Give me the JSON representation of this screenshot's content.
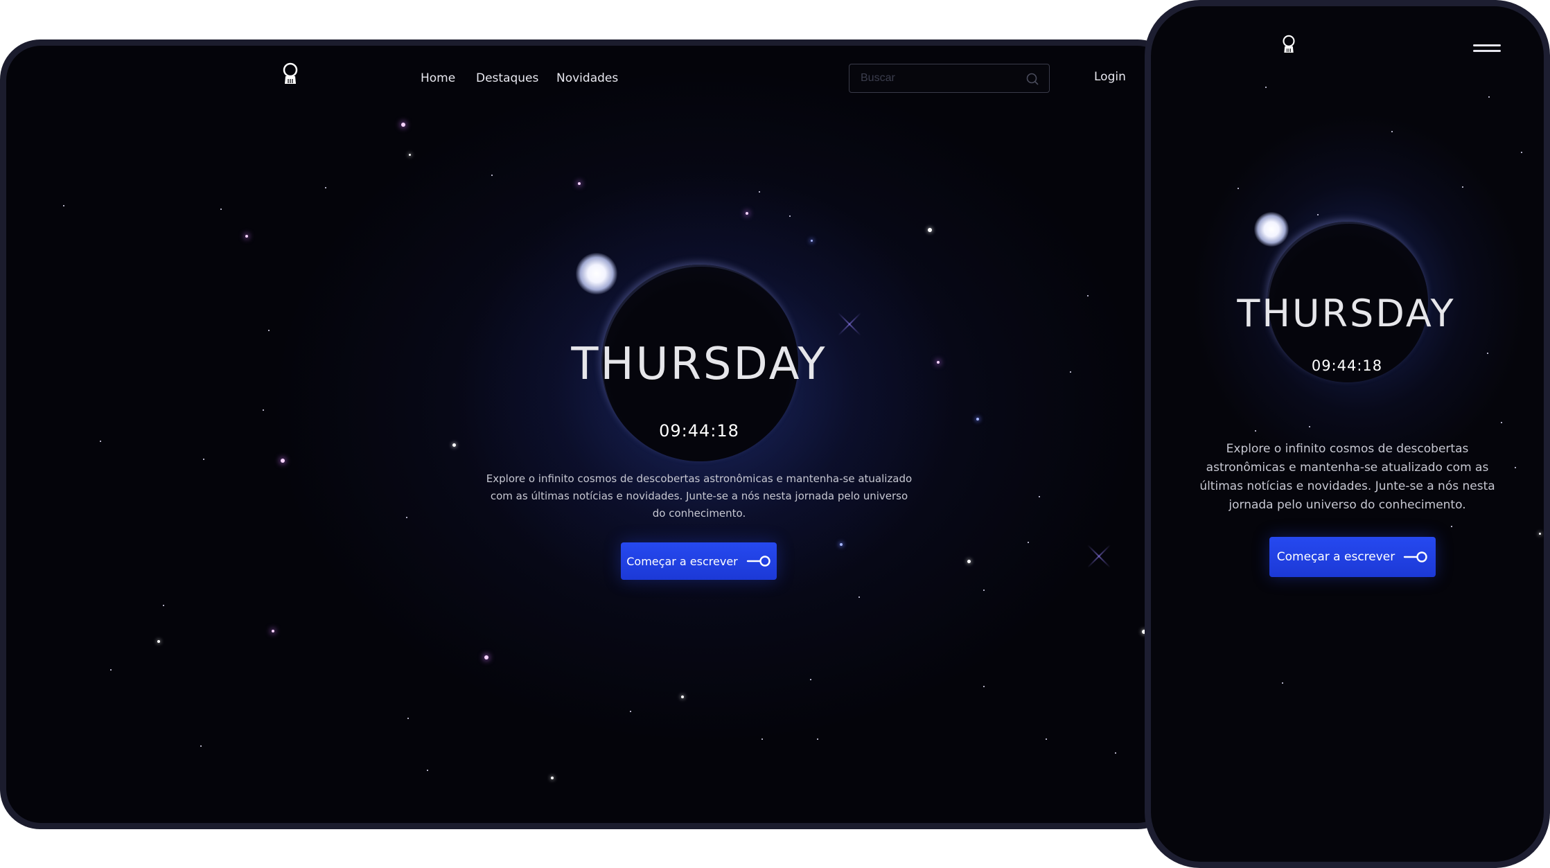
{
  "nav": {
    "links": [
      "Home",
      "Destaques",
      "Novidades"
    ],
    "search_placeholder": "Buscar",
    "login": "Login"
  },
  "hero": {
    "day": "THURSDAY",
    "time": "09:44:18",
    "description": "Explore o infinito cosmos de descobertas astronômicas e mantenha-se atualizado com as últimas notícias e novidades. Junte-se a nós nesta jornada pelo universo do conhecimento.",
    "cta_label": "Começar a escrever"
  },
  "icons": {
    "logo": "astronaut-helmet-icon",
    "search": "search-icon",
    "cta": "key-arrow-icon",
    "menu": "hamburger-menu-icon"
  },
  "colors": {
    "background": "#04040a",
    "accent": "#2649f0",
    "frame": "#1b1c2d",
    "text": "#e6e6ea"
  }
}
